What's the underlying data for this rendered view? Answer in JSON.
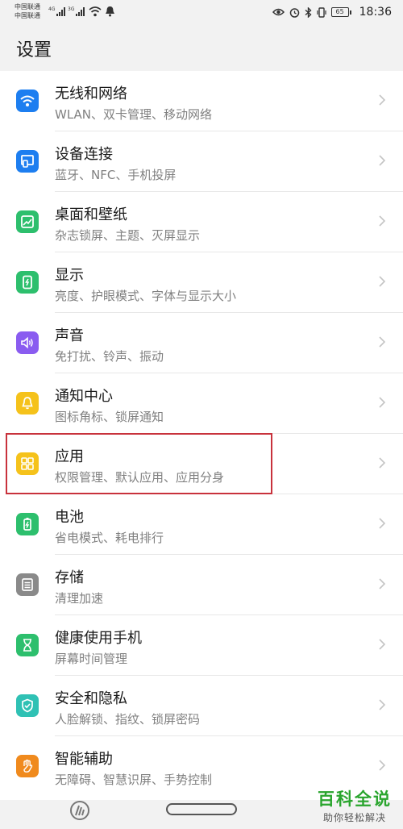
{
  "status_bar": {
    "carrier_1": "中国联通",
    "carrier_2": "中国联通",
    "network_1": "4G",
    "network_2": "3G",
    "battery_level": "65",
    "time": "18:36"
  },
  "page": {
    "title": "设置"
  },
  "settings": [
    {
      "title": "无线和网络",
      "subtitle": "WLAN、双卡管理、移动网络",
      "icon": "wifi-icon",
      "color": "#1d7ef0"
    },
    {
      "title": "设备连接",
      "subtitle": "蓝牙、NFC、手机投屏",
      "icon": "device-connection-icon",
      "color": "#1d7ef0"
    },
    {
      "title": "桌面和壁纸",
      "subtitle": "杂志锁屏、主题、灭屏显示",
      "icon": "wallpaper-icon",
      "color": "#2dbf6d"
    },
    {
      "title": "显示",
      "subtitle": "亮度、护眼模式、字体与显示大小",
      "icon": "display-icon",
      "color": "#2dbf6d"
    },
    {
      "title": "声音",
      "subtitle": "免打扰、铃声、振动",
      "icon": "sound-icon",
      "color": "#8a5cf0"
    },
    {
      "title": "通知中心",
      "subtitle": "图标角标、锁屏通知",
      "icon": "notification-bell-icon",
      "color": "#f5c21b"
    },
    {
      "title": "应用",
      "subtitle": "权限管理、默认应用、应用分身",
      "icon": "apps-grid-icon",
      "color": "#f5c21b"
    },
    {
      "title": "电池",
      "subtitle": "省电模式、耗电排行",
      "icon": "battery-icon",
      "color": "#2dbf6d"
    },
    {
      "title": "存储",
      "subtitle": "清理加速",
      "icon": "storage-icon",
      "color": "#8a8a8a"
    },
    {
      "title": "健康使用手机",
      "subtitle": "屏幕时间管理",
      "icon": "hourglass-icon",
      "color": "#2dbf6d"
    },
    {
      "title": "安全和隐私",
      "subtitle": "人脸解锁、指纹、锁屏密码",
      "icon": "shield-icon",
      "color": "#2fc1b4"
    },
    {
      "title": "智能辅助",
      "subtitle": "无障碍、智慧识屏、手势控制",
      "icon": "hand-icon",
      "color": "#f08a1d"
    }
  ],
  "highlight_color": "#c8323c",
  "watermark": {
    "title": "百科全说",
    "subtitle": "助你轻松解决"
  }
}
